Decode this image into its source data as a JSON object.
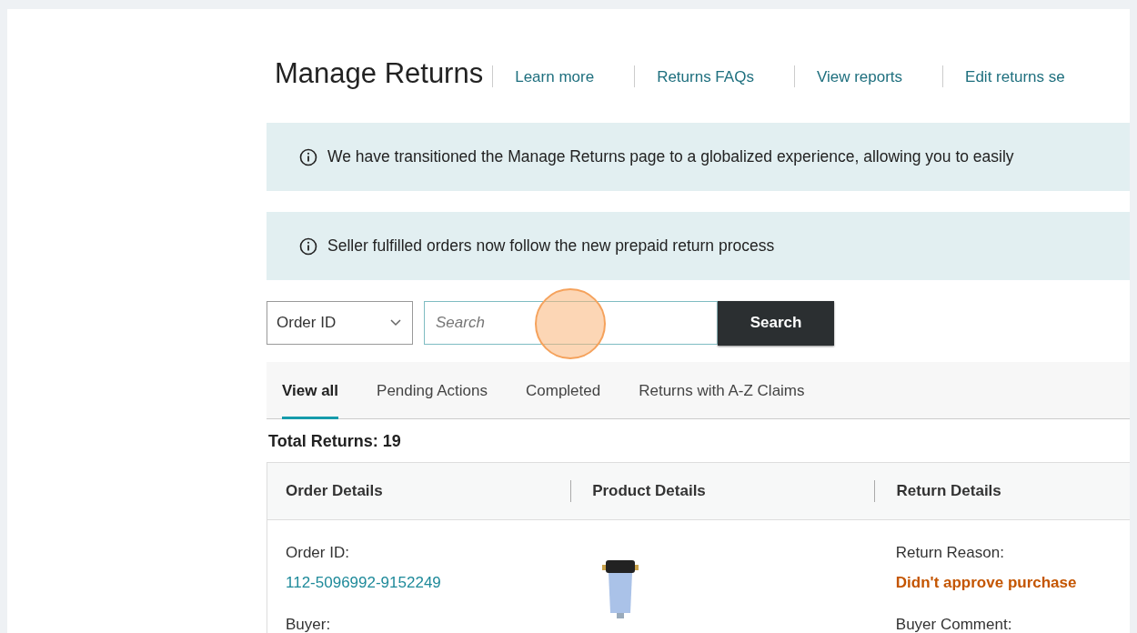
{
  "page": {
    "title": "Manage Returns"
  },
  "header_links": [
    "Learn more",
    "Returns FAQs",
    "View reports",
    "Edit returns se"
  ],
  "banners": [
    {
      "text": "We have transitioned the Manage Returns page to a globalized experience, allowing you to easily"
    },
    {
      "text": "Seller fulfilled orders now follow the new prepaid return process"
    }
  ],
  "search": {
    "filter": "Order ID",
    "placeholder": "Search",
    "button": "Search"
  },
  "tabs": [
    {
      "label": "View all",
      "selected": true
    },
    {
      "label": "Pending Actions",
      "selected": false
    },
    {
      "label": "Completed",
      "selected": false
    },
    {
      "label": "Returns with A-Z Claims",
      "selected": false
    }
  ],
  "total": "Total Returns: 19",
  "table": {
    "columns": [
      "Order Details",
      "Product Details",
      "Return Details"
    ],
    "rows": [
      {
        "order_label": "Order ID:",
        "order_id": "112-5096992-9152249",
        "buyer_label": "Buyer:",
        "reason_label": "Return Reason:",
        "reason": "Didn't approve purchase",
        "comment_label": "Buyer Comment:"
      }
    ]
  }
}
